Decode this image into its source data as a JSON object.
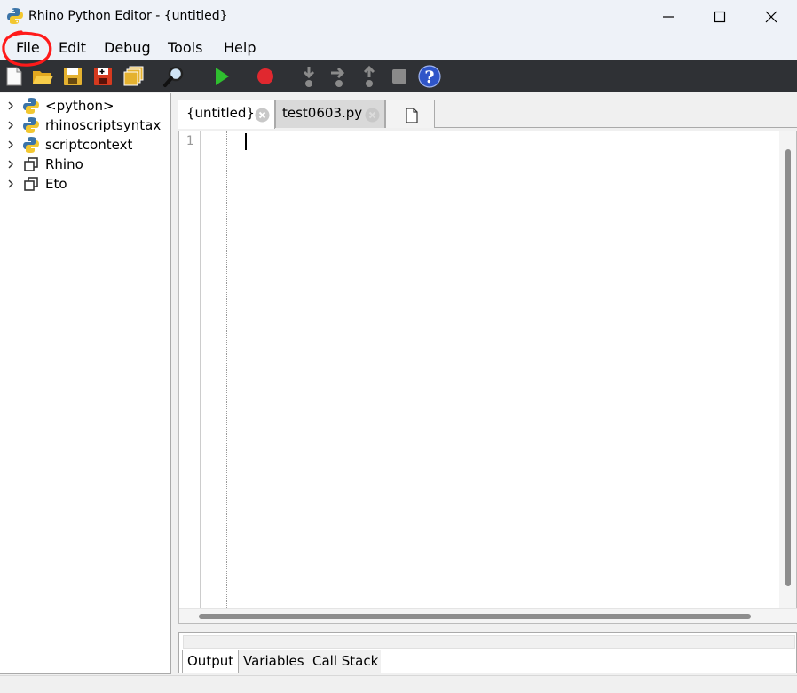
{
  "window": {
    "title": "Rhino Python Editor - {untitled}",
    "app_icon": "python-icon",
    "controls": [
      "minimize-icon",
      "maximize-icon",
      "close-icon"
    ]
  },
  "menu": {
    "items": [
      {
        "label": "File"
      },
      {
        "label": "Edit"
      },
      {
        "label": "Debug"
      },
      {
        "label": "Tools"
      },
      {
        "label": "Help"
      }
    ]
  },
  "toolbar": {
    "buttons": [
      "new-file-icon",
      "open-folder-icon",
      "save-icon",
      "save-as-icon",
      "save-all-icon",
      "find-icon",
      "run-icon",
      "stop-icon",
      "step-into-icon",
      "step-over-icon",
      "step-out-icon",
      "pause-icon",
      "help-icon"
    ]
  },
  "tree": {
    "items": [
      {
        "label": "<python>",
        "icon": "python-icon"
      },
      {
        "label": "rhinoscriptsyntax",
        "icon": "python-icon"
      },
      {
        "label": "scriptcontext",
        "icon": "python-icon"
      },
      {
        "label": "Rhino",
        "icon": "namespace-icon"
      },
      {
        "label": "Eto",
        "icon": "namespace-icon"
      }
    ]
  },
  "tabs": [
    {
      "label": "{untitled}",
      "active": true
    },
    {
      "label": "test0603.py",
      "active": false
    }
  ],
  "editor": {
    "line_numbers": [
      "1"
    ]
  },
  "bottom_tabs": [
    {
      "label": "Output",
      "active": true
    },
    {
      "label": "Variables",
      "active": false
    },
    {
      "label": "Call Stack",
      "active": false
    }
  ],
  "colors": {
    "toolbar_bg": "#2f3135",
    "annotation": "#ff1a1a",
    "run_green": "#2fbf2f",
    "stop_red": "#e0282f"
  }
}
